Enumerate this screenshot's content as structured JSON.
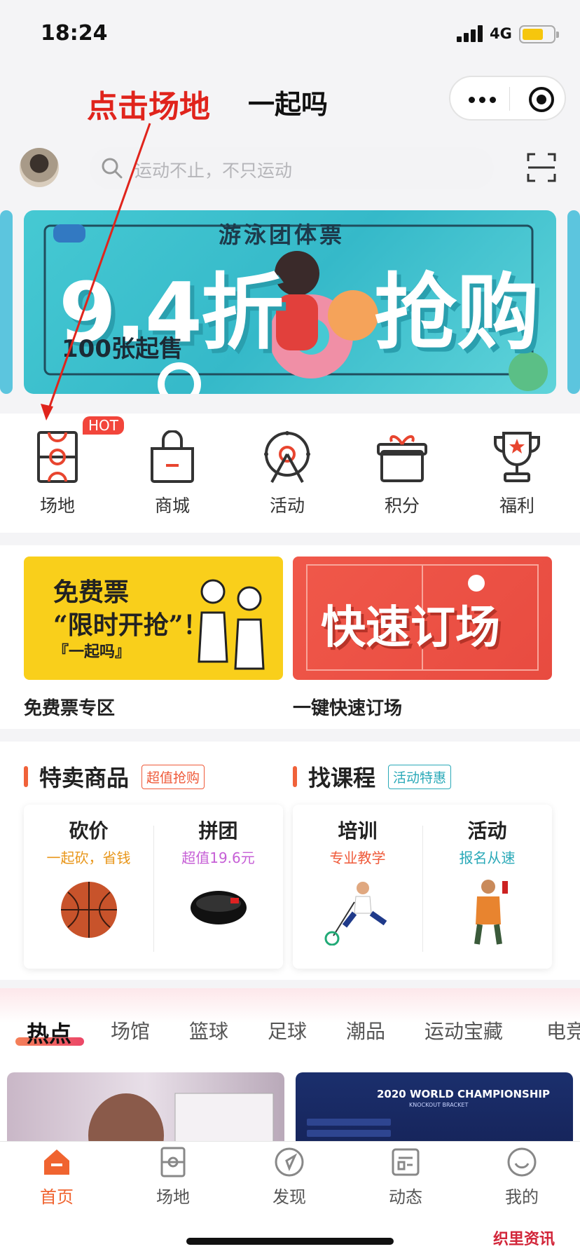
{
  "status_bar": {
    "time": "18:24",
    "network": "4G"
  },
  "annotation": "点击场地",
  "header": {
    "title": "一起吗"
  },
  "search": {
    "placeholder": "运动不止，不只运动"
  },
  "banner": {
    "subtitle": "游泳团体票",
    "discount": "9.4折",
    "action": "抢购",
    "note": "100张起售"
  },
  "quick_nav": {
    "hot_badge": "HOT",
    "items": [
      {
        "label": "场地",
        "icon": "court-icon"
      },
      {
        "label": "商城",
        "icon": "shopping-bag-icon"
      },
      {
        "label": "活动",
        "icon": "ferris-wheel-icon"
      },
      {
        "label": "积分",
        "icon": "gift-box-icon"
      },
      {
        "label": "福利",
        "icon": "trophy-icon"
      }
    ]
  },
  "promo": [
    {
      "image_text": [
        "免费票",
        "“限时开抢”！",
        "『一起吗』"
      ],
      "caption": "免费票专区"
    },
    {
      "image_text": [
        "快速订场"
      ],
      "caption": "一键快速订场"
    }
  ],
  "sections": [
    {
      "title": "特卖商品",
      "tag": "超值抢购",
      "items": [
        {
          "name": "砍价",
          "sub": "一起砍，省钱",
          "sub_color": "#e8961a"
        },
        {
          "name": "拼团",
          "sub": "超值19.6元",
          "sub_color": "#c65fd6"
        }
      ]
    },
    {
      "title": "找课程",
      "tag": "活动特惠",
      "items": [
        {
          "name": "培训",
          "sub": "专业教学",
          "sub_color": "#ef5a3a"
        },
        {
          "name": "活动",
          "sub": "报名从速",
          "sub_color": "#2aa9b8"
        }
      ]
    }
  ],
  "feed_tabs": [
    "热点",
    "场馆",
    "篮球",
    "足球",
    "潮品",
    "运动宝藏",
    "电竞"
  ],
  "feed_card": {
    "headline": "2020 WORLD CHAMPIONSHIP",
    "sub": "KNOCKOUT BRACKET"
  },
  "tab_bar": [
    {
      "label": "首页",
      "active": true
    },
    {
      "label": "场地"
    },
    {
      "label": "发现"
    },
    {
      "label": "动态"
    },
    {
      "label": "我的"
    }
  ],
  "watermark": "织里资讯",
  "colors": {
    "accent": "#f06430",
    "annotation": "#e0241c",
    "banner": "#46c9d3"
  }
}
